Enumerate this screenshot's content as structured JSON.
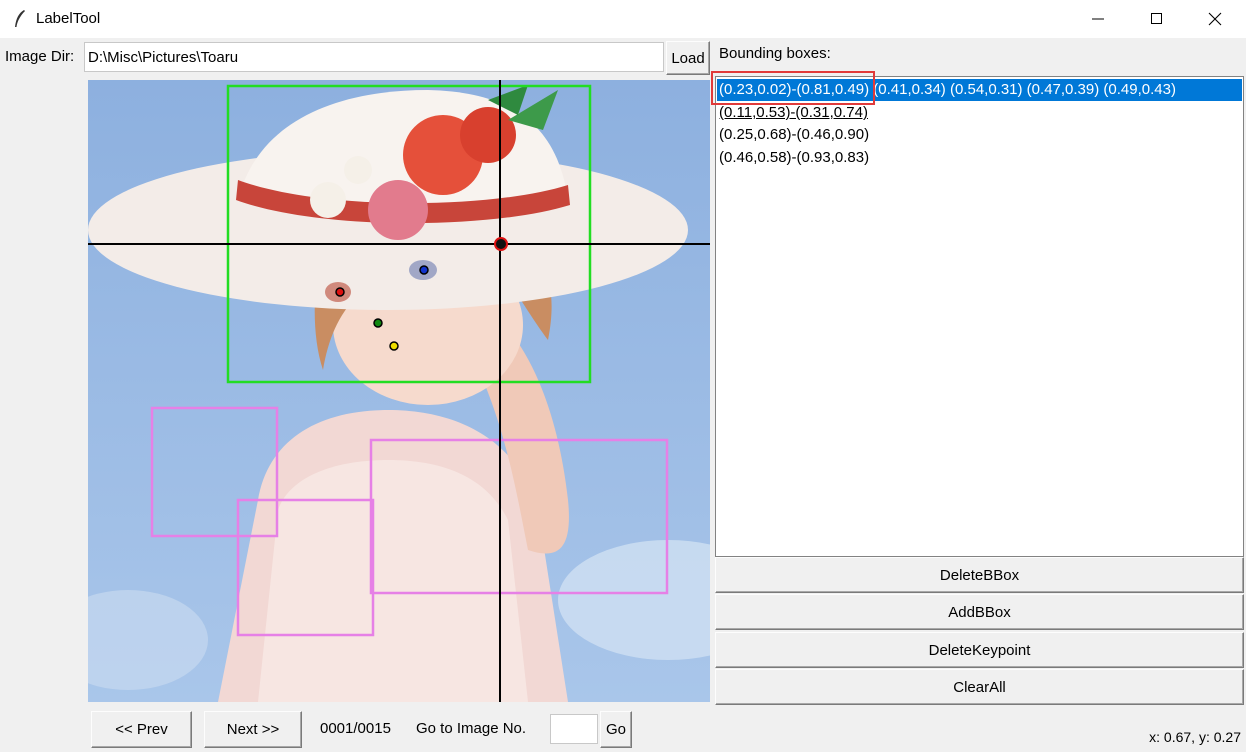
{
  "window": {
    "title": "LabelTool"
  },
  "dir": {
    "label": "Image Dir:",
    "value": "D:\\Misc\\Pictures\\Toaru",
    "load_label": "Load"
  },
  "bboxes": {
    "label": "Bounding boxes:",
    "items": [
      "(0.23,0.02)-(0.81,0.49) (0.41,0.34) (0.54,0.31) (0.47,0.39) (0.49,0.43)",
      "(0.11,0.53)-(0.31,0.74)",
      "(0.25,0.68)-(0.46,0.90)",
      "(0.46,0.58)-(0.93,0.83)"
    ],
    "selected_index": 0
  },
  "actions": {
    "delete_bbox": "DeleteBBox",
    "add_bbox": "AddBBox",
    "delete_keypoint": "DeleteKeypoint",
    "clear_all": "ClearAll"
  },
  "nav": {
    "prev": "<< Prev",
    "next": "Next >>",
    "progress": "0001/0015",
    "goto_label": "Go to Image No.",
    "goto_value": "",
    "go": "Go"
  },
  "status": {
    "coords": "x: 0.67, y: 0.27"
  },
  "colors": {
    "bbox_selected": "#22dd22",
    "bbox_other": "#e680e6",
    "crosshair": "#000000",
    "keypoints": [
      "#dd1111",
      "#1133cc",
      "#118811",
      "#eedd00"
    ],
    "selection": "#0078d7",
    "annotation_frame": "#e03a3a"
  }
}
